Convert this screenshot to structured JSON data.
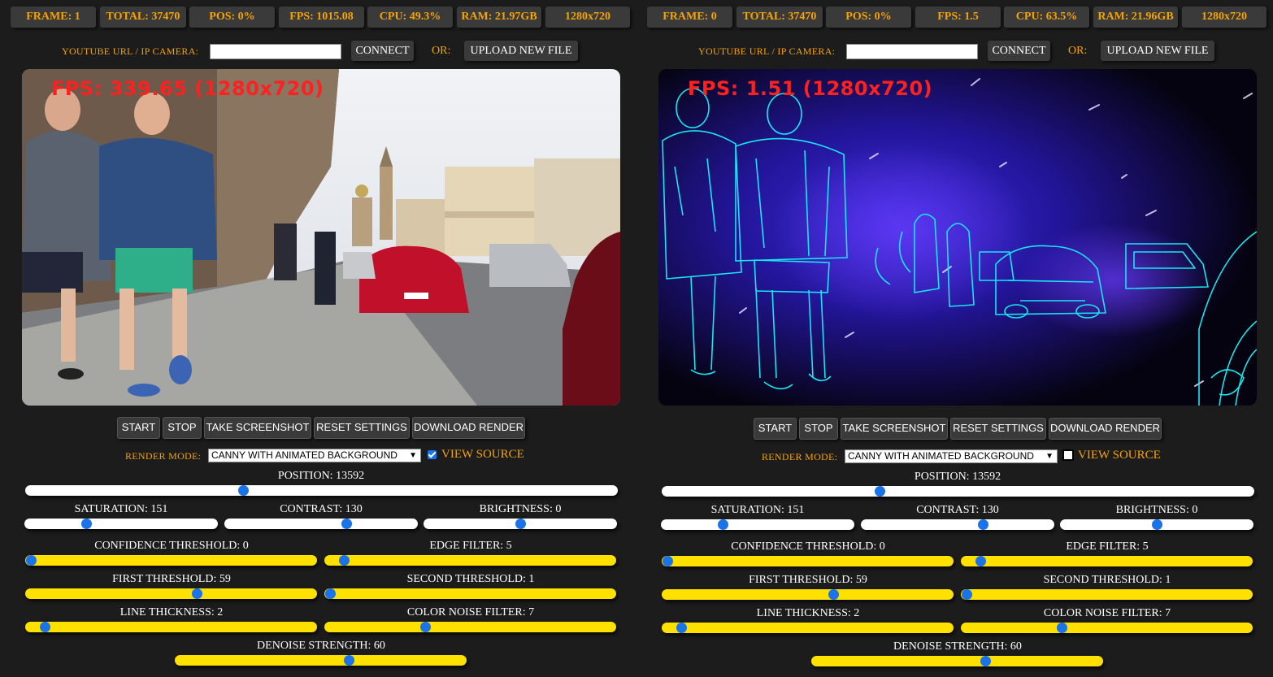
{
  "panels": [
    {
      "id": "left",
      "stats": [
        {
          "label": "FRAME: 1"
        },
        {
          "label": "TOTAL: 37470"
        },
        {
          "label": "POS: 0%"
        },
        {
          "label": "FPS: 1015.08"
        },
        {
          "label": "CPU: 49.3%"
        },
        {
          "label": "RAM: 21.97GB"
        },
        {
          "label": "1280x720"
        }
      ],
      "url_label": "YOUTUBE URL / IP CAMERA:",
      "url_value": "",
      "connect_label": "CONNECT",
      "or_label": "OR:",
      "upload_label": "UPLOAD NEW FILE",
      "fps_overlay": "FPS: 339.65 (1280x720)",
      "buttons": [
        "START",
        "STOP",
        "TAKE SCREENSHOT",
        "RESET SETTINGS",
        "DOWNLOAD RENDER"
      ],
      "render_mode_label": "RENDER MODE:",
      "render_mode_value": "CANNY WITH ANIMATED BACKGROUND",
      "view_source_label": "VIEW SOURCE",
      "view_source_checked": true,
      "sliders": {
        "position": {
          "label": "POSITION: 13592",
          "fraction": 0.365
        },
        "saturation": {
          "label": "SATURATION: 151",
          "fraction": 0.31
        },
        "contrast": {
          "label": "CONTRAST: 130",
          "fraction": 0.64
        },
        "brightness": {
          "label": "BRIGHTNESS: 0",
          "fraction": 0.5
        },
        "confidence": {
          "label": "CONFIDENCE THRESHOLD: 0",
          "fraction": 0.0
        },
        "edge_filter": {
          "label": "EDGE FILTER: 5",
          "fraction": 0.05
        },
        "first_threshold": {
          "label": "FIRST THRESHOLD: 59",
          "fraction": 0.59
        },
        "second_threshold": {
          "label": "SECOND THRESHOLD: 1",
          "fraction": 0.0
        },
        "line_thickness": {
          "label": "LINE THICKNESS: 2",
          "fraction": 0.05
        },
        "color_noise": {
          "label": "COLOR NOISE FILTER: 7",
          "fraction": 0.34
        },
        "denoise": {
          "label": "DENOISE STRENGTH: 60",
          "fraction": 0.6
        }
      }
    },
    {
      "id": "right",
      "stats": [
        {
          "label": "FRAME: 0"
        },
        {
          "label": "TOTAL: 37470"
        },
        {
          "label": "POS: 0%"
        },
        {
          "label": "FPS: 1.5"
        },
        {
          "label": "CPU: 63.5%"
        },
        {
          "label": "RAM: 21.96GB"
        },
        {
          "label": "1280x720"
        }
      ],
      "url_label": "YOUTUBE URL / IP CAMERA:",
      "url_value": "",
      "connect_label": "CONNECT",
      "or_label": "OR:",
      "upload_label": "UPLOAD NEW FILE",
      "fps_overlay": "FPS: 1.51 (1280x720)",
      "buttons": [
        "START",
        "STOP",
        "TAKE SCREENSHOT",
        "RESET SETTINGS",
        "DOWNLOAD RENDER"
      ],
      "render_mode_label": "RENDER MODE:",
      "render_mode_value": "CANNY WITH ANIMATED BACKGROUND",
      "view_source_label": "VIEW SOURCE",
      "view_source_checked": false,
      "sliders": {
        "position": {
          "label": "POSITION: 13592",
          "fraction": 0.365
        },
        "saturation": {
          "label": "SATURATION: 151",
          "fraction": 0.31
        },
        "contrast": {
          "label": "CONTRAST: 130",
          "fraction": 0.64
        },
        "brightness": {
          "label": "BRIGHTNESS: 0",
          "fraction": 0.5
        },
        "confidence": {
          "label": "CONFIDENCE THRESHOLD: 0",
          "fraction": 0.0
        },
        "edge_filter": {
          "label": "EDGE FILTER: 5",
          "fraction": 0.05
        },
        "first_threshold": {
          "label": "FIRST THRESHOLD: 59",
          "fraction": 0.59
        },
        "second_threshold": {
          "label": "SECOND THRESHOLD: 1",
          "fraction": 0.0
        },
        "line_thickness": {
          "label": "LINE THICKNESS: 2",
          "fraction": 0.05
        },
        "color_noise": {
          "label": "COLOR NOISE FILTER: 7",
          "fraction": 0.34
        },
        "denoise": {
          "label": "DENOISE STRENGTH: 60",
          "fraction": 0.6
        }
      }
    }
  ],
  "colors": {
    "accent": "#f5a300",
    "panel_bg": "#1c1c1c",
    "button_bg": "#3a3a3a",
    "slider_white": "#ffffff",
    "slider_yellow": "#ffe100",
    "thumb": "#1a73e8",
    "fps_overlay": "#ff2020",
    "canny_edges": "#19e6f0"
  },
  "icons": {
    "select_arrow": "chevron-down-icon",
    "checkbox": "checkbox-icon"
  }
}
